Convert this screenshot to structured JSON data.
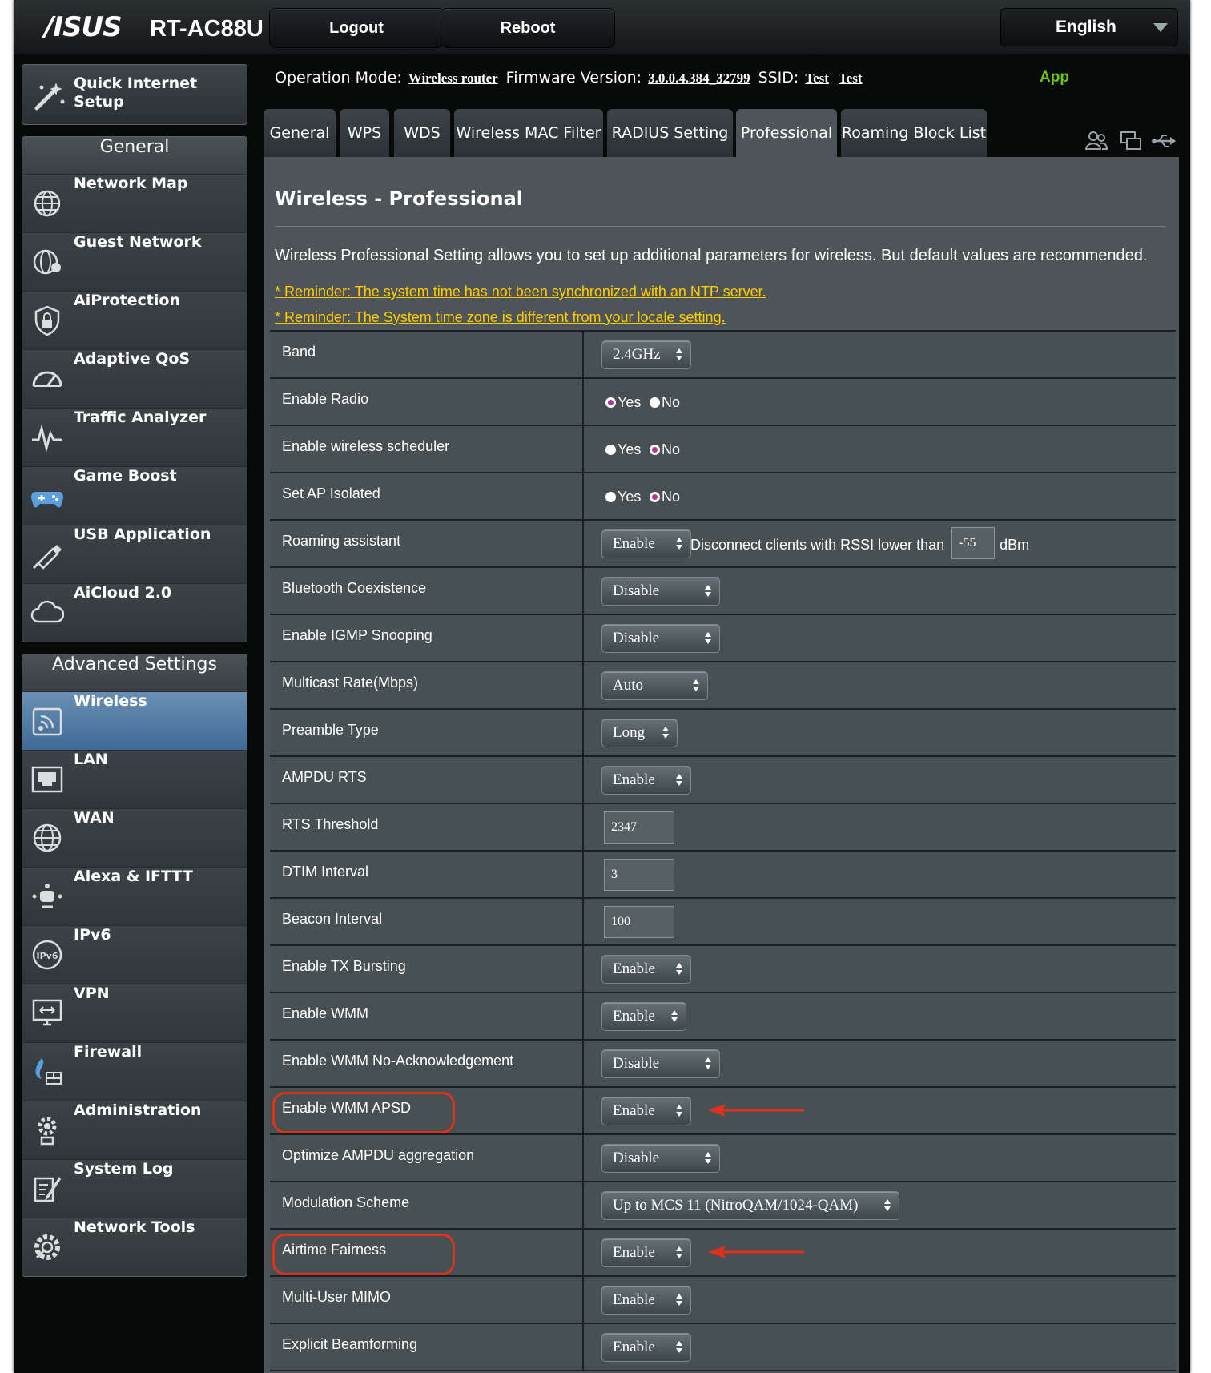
{
  "header": {
    "brand": "/ISUS",
    "model": "RT-AC88U",
    "logout_label": "Logout",
    "reboot_label": "Reboot",
    "language": "English"
  },
  "status": {
    "operation_mode_label": "Operation Mode:",
    "operation_mode_value": "Wireless router",
    "firmware_label": "Firmware Version:",
    "firmware_value": "3.0.0.4.384_32799",
    "ssid_label": "SSID:",
    "ssid_values": [
      "Test",
      "Test"
    ],
    "app_label": "App",
    "icons": [
      "users-icon",
      "windows-icon",
      "usb-icon"
    ]
  },
  "sidebar": {
    "quick_setup": {
      "label": "Quick Internet Setup",
      "icon": "magic-wand-icon"
    },
    "general_title": "General",
    "general": [
      {
        "label": "Network Map",
        "icon": "globe-network-icon"
      },
      {
        "label": "Guest Network",
        "icon": "guest-globe-icon"
      },
      {
        "label": "AiProtection",
        "icon": "shield-lock-icon"
      },
      {
        "label": "Adaptive QoS",
        "icon": "speedometer-icon"
      },
      {
        "label": "Traffic Analyzer",
        "icon": "pulse-icon"
      },
      {
        "label": "Game Boost",
        "icon": "gamepad-icon"
      },
      {
        "label": "USB Application",
        "icon": "usb-plug-icon"
      },
      {
        "label": "AiCloud 2.0",
        "icon": "cloud-icon"
      }
    ],
    "advanced_title": "Advanced Settings",
    "advanced": [
      {
        "label": "Wireless",
        "icon": "wifi-icon",
        "active": true
      },
      {
        "label": "LAN",
        "icon": "lan-port-icon"
      },
      {
        "label": "WAN",
        "icon": "globe-icon"
      },
      {
        "label": "Alexa & IFTTT",
        "icon": "voice-assistant-icon"
      },
      {
        "label": "IPv6",
        "icon": "ipv6-icon"
      },
      {
        "label": "VPN",
        "icon": "vpn-monitor-icon"
      },
      {
        "label": "Firewall",
        "icon": "firewall-icon"
      },
      {
        "label": "Administration",
        "icon": "admin-gear-icon"
      },
      {
        "label": "System Log",
        "icon": "log-pen-icon"
      },
      {
        "label": "Network Tools",
        "icon": "tools-gear-icon"
      }
    ]
  },
  "tabs": [
    {
      "label": "General"
    },
    {
      "label": "WPS"
    },
    {
      "label": "WDS"
    },
    {
      "label": "Wireless MAC Filter"
    },
    {
      "label": "RADIUS Setting"
    },
    {
      "label": "Professional",
      "active": true
    },
    {
      "label": "Roaming Block List"
    }
  ],
  "page": {
    "title": "Wireless - Professional",
    "description": "Wireless Professional Setting allows you to set up additional parameters for wireless. But default values are recommended.",
    "reminders": [
      "* Reminder: The system time has not been synchronized with an NTP server.",
      "* Reminder: The System time zone is different from your locale setting."
    ]
  },
  "radio_labels": {
    "yes": "Yes",
    "no": "No"
  },
  "settings": [
    {
      "label": "Band",
      "type": "select",
      "value": "2.4GHz"
    },
    {
      "label": "Enable Radio",
      "type": "radio",
      "value": "Yes"
    },
    {
      "label": "Enable wireless scheduler",
      "type": "radio",
      "value": "No"
    },
    {
      "label": "Set AP Isolated",
      "type": "radio",
      "value": "No"
    },
    {
      "label": "Roaming assistant",
      "type": "select",
      "value": "Enable",
      "extra_text": "Disconnect clients with RSSI lower than",
      "extra_value": "-55",
      "extra_unit": "dBm"
    },
    {
      "label": "Bluetooth Coexistence",
      "type": "select",
      "value": "Disable"
    },
    {
      "label": "Enable IGMP Snooping",
      "type": "select",
      "value": "Disable"
    },
    {
      "label": "Multicast Rate(Mbps)",
      "type": "select",
      "value": "Auto"
    },
    {
      "label": "Preamble Type",
      "type": "select",
      "value": "Long"
    },
    {
      "label": "AMPDU RTS",
      "type": "select",
      "value": "Enable"
    },
    {
      "label": "RTS Threshold",
      "type": "text",
      "value": "2347"
    },
    {
      "label": "DTIM Interval",
      "type": "text",
      "value": "3"
    },
    {
      "label": "Beacon Interval",
      "type": "text",
      "value": "100"
    },
    {
      "label": "Enable TX Bursting",
      "type": "select",
      "value": "Enable"
    },
    {
      "label": "Enable WMM",
      "type": "select",
      "value": "Enable"
    },
    {
      "label": "Enable WMM No-Acknowledgement",
      "type": "select",
      "value": "Disable"
    },
    {
      "label": "Enable WMM APSD",
      "type": "select",
      "value": "Enable",
      "highlighted": true
    },
    {
      "label": "Optimize AMPDU aggregation",
      "type": "select",
      "value": "Disable"
    },
    {
      "label": "Modulation Scheme",
      "type": "select",
      "value": "Up to MCS 11 (NitroQAM/1024-QAM)"
    },
    {
      "label": "Airtime Fairness",
      "type": "select",
      "value": "Enable",
      "highlighted": true
    },
    {
      "label": "Multi-User MIMO",
      "type": "select",
      "value": "Enable"
    },
    {
      "label": "Explicit Beamforming",
      "type": "select",
      "value": "Enable"
    }
  ],
  "colors": {
    "accent_app": "#6cc417",
    "reminder": "#ffcc00",
    "annotation": "#e0311d",
    "active_nav": "#4f7aa5",
    "radio_checked": "#b0389b"
  }
}
